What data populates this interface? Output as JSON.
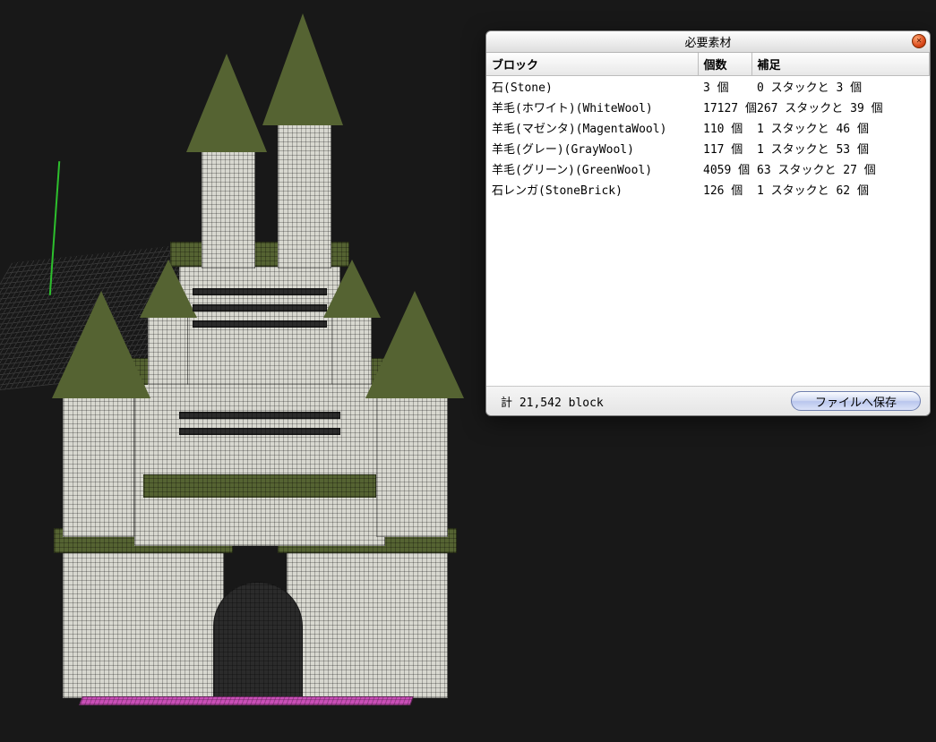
{
  "dialog": {
    "title": "必要素材",
    "headers": {
      "block": "ブロック",
      "count": "個数",
      "detail": "補足"
    },
    "rows": [
      {
        "block": "石(Stone)",
        "count": "3 個",
        "detail": "0 スタックと 3 個"
      },
      {
        "block": "羊毛(ホワイト)(WhiteWool)",
        "count": "17127 個",
        "detail": "267 スタックと 39 個"
      },
      {
        "block": "羊毛(マゼンタ)(MagentaWool)",
        "count": "110 個",
        "detail": "1 スタックと 46 個"
      },
      {
        "block": "羊毛(グレー)(GrayWool)",
        "count": "117 個",
        "detail": "1 スタックと 53 個"
      },
      {
        "block": "羊毛(グリーン)(GreenWool)",
        "count": "4059 個",
        "detail": "63 スタックと 27 個"
      },
      {
        "block": "石レンガ(StoneBrick)",
        "count": "126 個",
        "detail": "1 スタックと 62 個"
      }
    ],
    "total": "計 21,542 block",
    "save_label": "ファイルへ保存",
    "close_tooltip": "close"
  }
}
